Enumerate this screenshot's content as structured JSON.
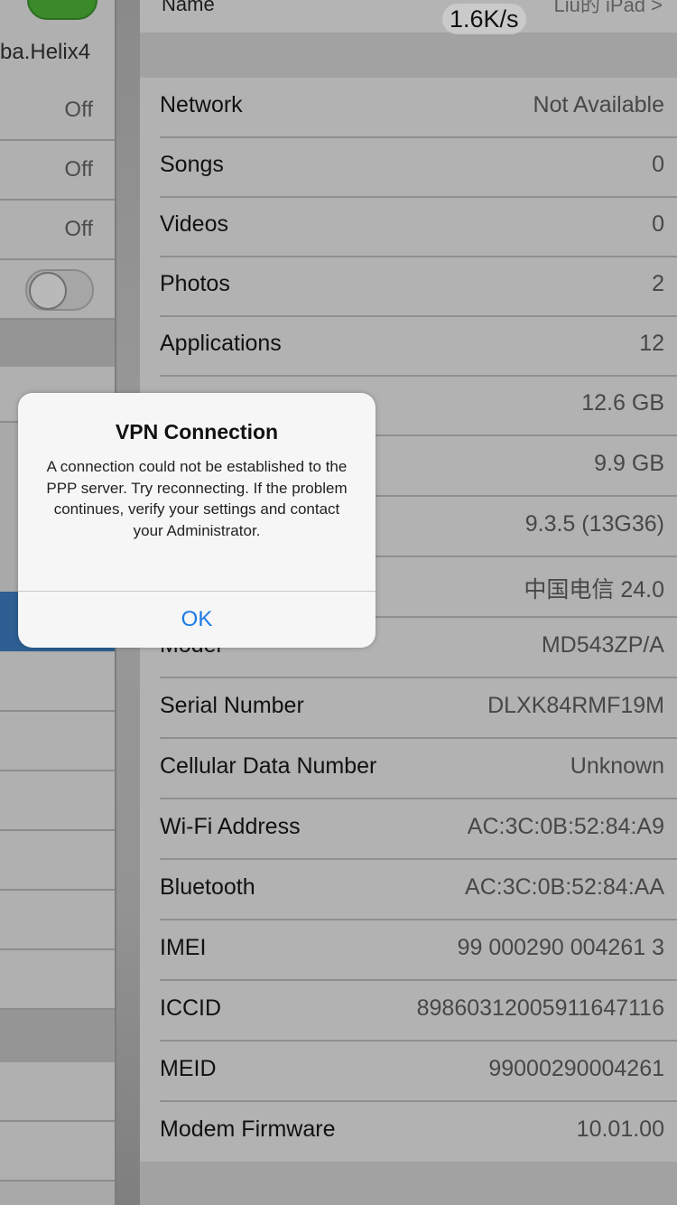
{
  "status": {
    "network_speed": "1.6K/s"
  },
  "left_pane": {
    "network_name": "ba.Helix4",
    "off_labels": [
      "Off",
      "Off",
      "Off"
    ]
  },
  "main": {
    "name_row": {
      "label": "Name",
      "value": "Liu的 iPad >"
    },
    "rows": [
      {
        "label": "Network",
        "value": "Not Available"
      },
      {
        "label": "Songs",
        "value": "0"
      },
      {
        "label": "Videos",
        "value": "0"
      },
      {
        "label": "Photos",
        "value": "2"
      },
      {
        "label": "Applications",
        "value": "12"
      },
      {
        "label": "",
        "value": "12.6 GB"
      },
      {
        "label": "",
        "value": "9.9 GB"
      },
      {
        "label": "",
        "value": "9.3.5 (13G36)"
      },
      {
        "label": "",
        "value": "中国电信 24.0"
      },
      {
        "label": "Model",
        "value": "MD543ZP/A"
      },
      {
        "label": "Serial Number",
        "value": "DLXK84RMF19M"
      },
      {
        "label": "Cellular Data Number",
        "value": "Unknown"
      },
      {
        "label": "Wi-Fi Address",
        "value": "AC:3C:0B:52:84:A9"
      },
      {
        "label": "Bluetooth",
        "value": "AC:3C:0B:52:84:AA"
      },
      {
        "label": "IMEI",
        "value": "99 000290 004261 3"
      },
      {
        "label": "ICCID",
        "value": "89860312005911647116"
      },
      {
        "label": "MEID",
        "value": "99000290004261"
      },
      {
        "label": "Modem Firmware",
        "value": "10.01.00"
      }
    ]
  },
  "alert": {
    "title": "VPN Connection",
    "message": "A connection could not be established to the PPP server. Try reconnecting. If the problem continues, verify your settings and contact your Administrator.",
    "ok_label": "OK"
  },
  "colors": {
    "alert_button": "#1c7ae6",
    "toggle_on": "#3a8a2a",
    "selected_row": "#2e5f93"
  }
}
